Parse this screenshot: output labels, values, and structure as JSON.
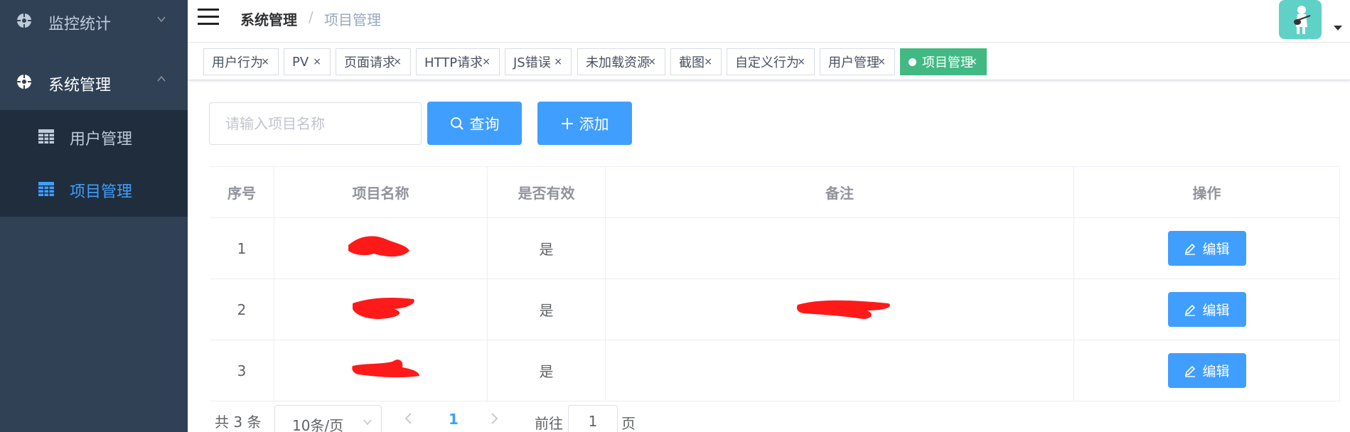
{
  "sidebar": {
    "monitor_label": "监控统计",
    "system_label": "系统管理",
    "sub_items": [
      {
        "label": "用户管理"
      },
      {
        "label": "项目管理"
      }
    ]
  },
  "header": {
    "breadcrumb": [
      "系统管理",
      "项目管理"
    ],
    "separator": "/"
  },
  "tags": [
    {
      "label": "用户行为",
      "active": false
    },
    {
      "label": "PV",
      "active": false
    },
    {
      "label": "页面请求",
      "active": false
    },
    {
      "label": "HTTP请求",
      "active": false
    },
    {
      "label": "JS错误",
      "active": false
    },
    {
      "label": "未加载资源",
      "active": false
    },
    {
      "label": "截图",
      "active": false
    },
    {
      "label": "自定义行为",
      "active": false
    },
    {
      "label": "用户管理",
      "active": false
    },
    {
      "label": "项目管理",
      "active": true
    }
  ],
  "tag_close": "×",
  "search": {
    "placeholder": "请输入项目名称",
    "query_label": "查询",
    "add_label": "添加"
  },
  "table": {
    "headers": [
      "序号",
      "项目名称",
      "是否有效",
      "备注",
      "操作"
    ],
    "rows": [
      {
        "index": "1",
        "valid": "是",
        "action": "编辑"
      },
      {
        "index": "2",
        "valid": "是",
        "action": "编辑"
      },
      {
        "index": "3",
        "valid": "是",
        "action": "编辑"
      }
    ]
  },
  "pagination": {
    "total": "共 3 条",
    "page_size": "10条/页",
    "current": "1",
    "goto_label": "前往",
    "goto_value": "1",
    "page_label": "页"
  },
  "colors": {
    "sidebar_bg": "#304156",
    "submenu_bg": "#1f2d3d",
    "primary": "#409eff",
    "active_tag": "#42b983",
    "redaction": "#ff0000"
  }
}
